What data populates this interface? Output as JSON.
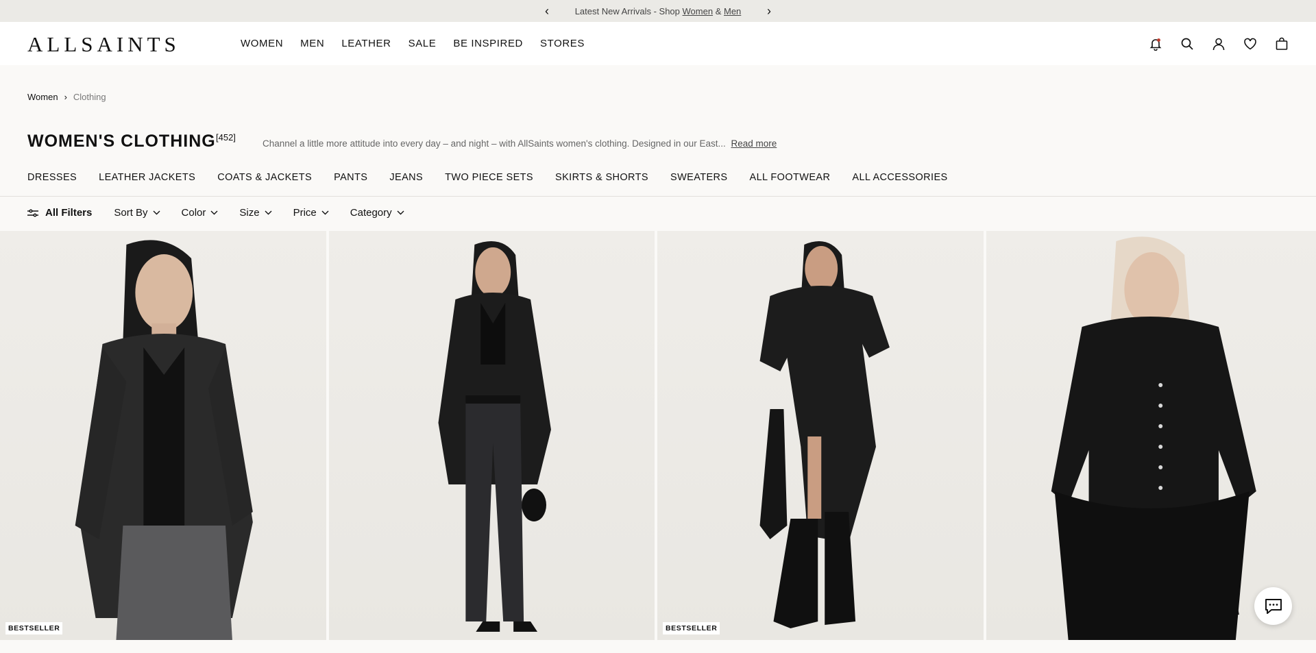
{
  "promo": {
    "message_prefix": "Latest New Arrivals - Shop",
    "link_women": "Women",
    "separator": "&",
    "link_men": "Men",
    "prev": "‹",
    "next": "›"
  },
  "header": {
    "logo": "ALLSAINTS",
    "nav": [
      "WOMEN",
      "MEN",
      "LEATHER",
      "SALE",
      "BE INSPIRED",
      "STORES"
    ],
    "icons": [
      "notification-bell-icon",
      "search-icon",
      "account-icon",
      "wishlist-heart-icon",
      "bag-icon"
    ]
  },
  "breadcrumb": {
    "items": [
      "Women",
      "Clothing"
    ],
    "separator": "›"
  },
  "page": {
    "title": "WOMEN'S CLOTHING",
    "count": "[452]",
    "description": "Channel a little more attitude into every day – and night – with AllSaints women's clothing. Designed in our East...",
    "read_more": "Read more"
  },
  "categories": [
    "DRESSES",
    "LEATHER JACKETS",
    "COATS & JACKETS",
    "PANTS",
    "JEANS",
    "TWO PIECE SETS",
    "SKIRTS & SHORTS",
    "SWEATERS",
    "ALL FOOTWEAR",
    "ALL ACCESSORIES"
  ],
  "filters": {
    "all_filters": "All Filters",
    "items": [
      "Sort By",
      "Color",
      "Size",
      "Price",
      "Category"
    ]
  },
  "products": [
    {
      "badge": "BESTSELLER"
    },
    {
      "badge": ""
    },
    {
      "badge": "BESTSELLER"
    },
    {
      "badge": ""
    }
  ],
  "colors": {
    "promo_bg": "#ebeae6",
    "page_bg": "#faf9f7",
    "text": "#111111"
  }
}
